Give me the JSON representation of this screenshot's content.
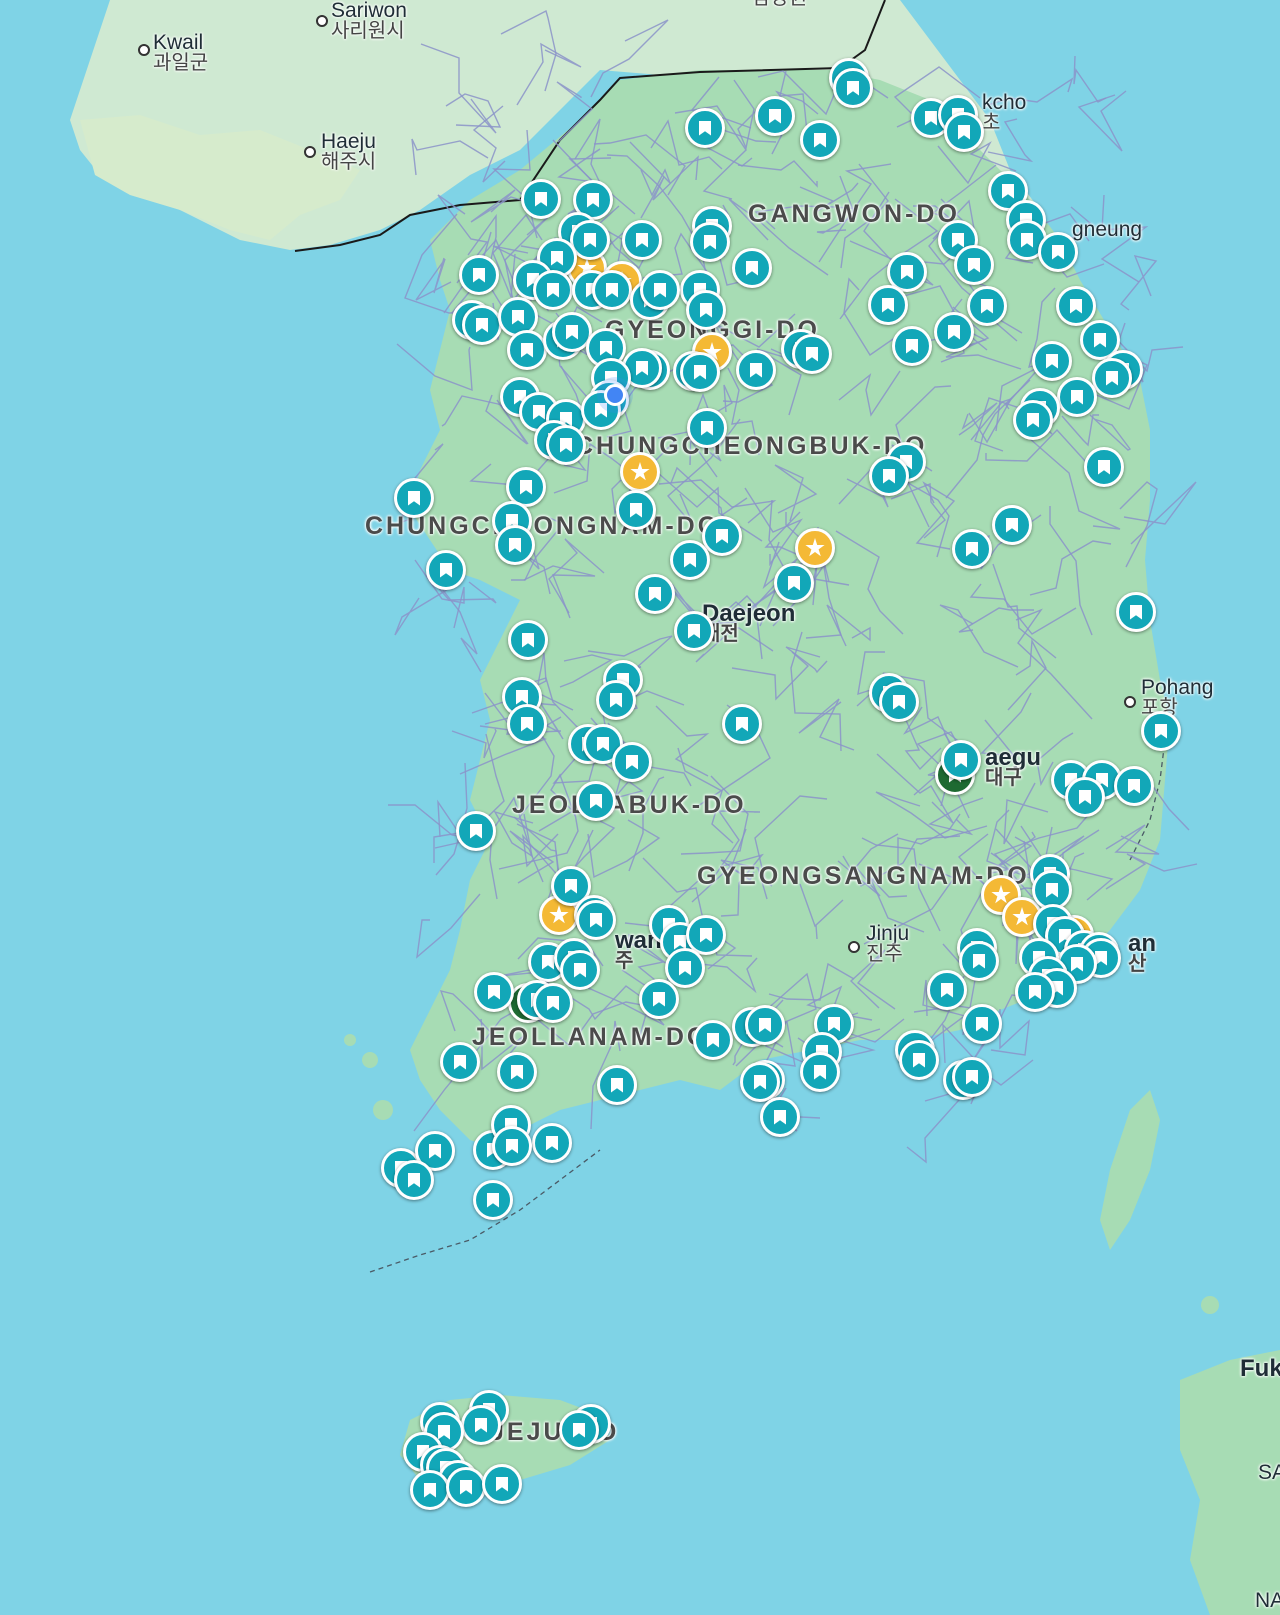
{
  "map": {
    "region_labels": [
      "GANGWON-DO",
      "GYEONGGI-DO",
      "CHUNGCHEONGBUK-DO",
      "CHUNGCHEONGNAM-DO",
      "JEOLLABUK-DO",
      "GYEONGSANGNAM-DO",
      "JEOLLANAM-DO",
      "JEJU-DO"
    ],
    "cities": {
      "kwail": {
        "en": "Kwail",
        "ko": "과일군"
      },
      "sariwon": {
        "en": "Sariwon",
        "ko": "사리원시"
      },
      "haeju": {
        "en": "Haeju",
        "ko": "해주시"
      },
      "sokcho": {
        "en": "kcho",
        "ko": "초"
      },
      "gangneung": {
        "en": "gneung",
        "ko": ""
      },
      "daejeon": {
        "en": "Daejeon",
        "ko": "대전"
      },
      "pohang": {
        "en": "Pohang",
        "ko": "포항"
      },
      "daegu": {
        "en": "aegu",
        "ko": "대구"
      },
      "jinju": {
        "en": "Jinju",
        "ko": "진주"
      },
      "busan": {
        "en": "an",
        "ko": "산"
      },
      "gwangju": {
        "en": "wan",
        "ko": "주"
      },
      "fukuoka": {
        "en": "Fuk",
        "ko": ""
      },
      "top_partial": {
        "en": "",
        "ko": "남강원"
      },
      "sa_partial": {
        "en": "SA",
        "ko": ""
      },
      "na_partial": {
        "en": "NA",
        "ko": ""
      }
    },
    "colors": {
      "sea": "#7fd3e6",
      "land": "#a7dcb4",
      "saved_pin": "#12a7b8",
      "starred_pin": "#f4b935",
      "green_pin": "#1e6a32",
      "location_dot": "#4285f4"
    },
    "icons": {
      "saved": "bookmark-icon",
      "starred": "star-icon",
      "location": "my-location-dot"
    }
  }
}
